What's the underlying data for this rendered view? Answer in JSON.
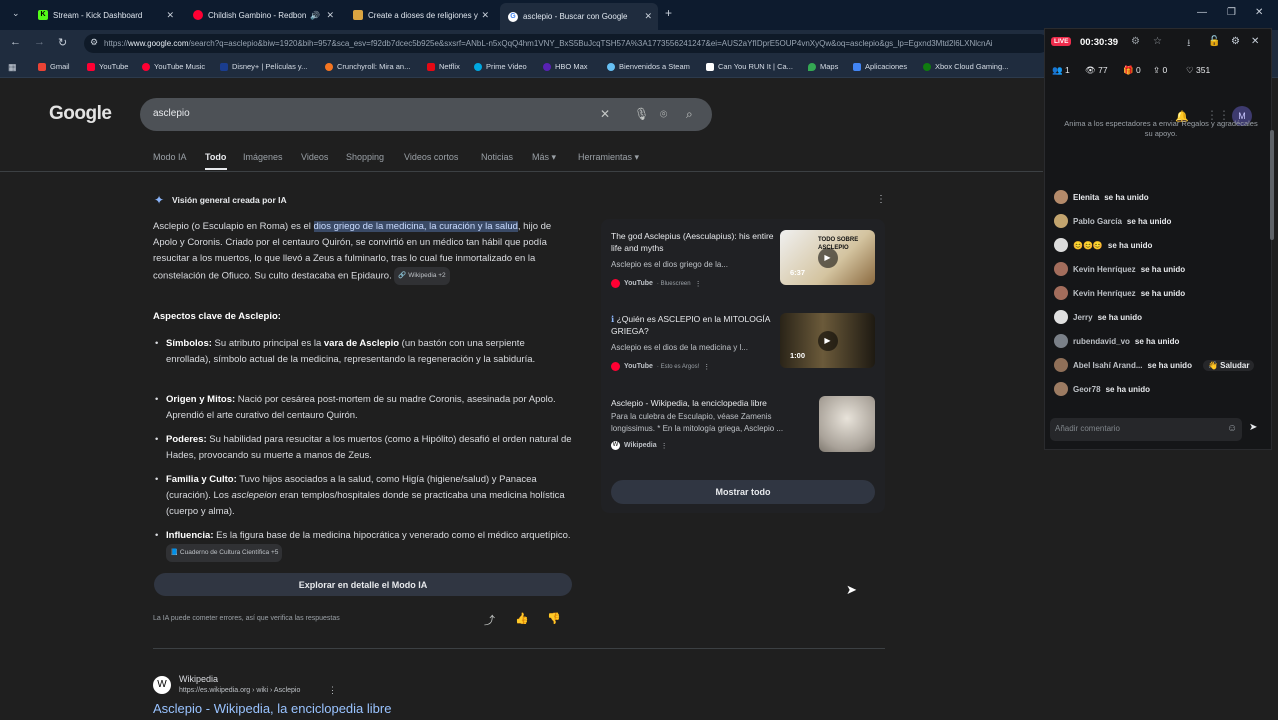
{
  "browser": {
    "tabs": [
      {
        "label": "Stream - Kick Dashboard",
        "favicon_color": "#53fc18"
      },
      {
        "label": "Childish Gambino - Redbone",
        "favicon_color": "#ff0033"
      },
      {
        "label": "Create a dioses de religiones y",
        "favicon_color": "#d9a441"
      },
      {
        "label": "asclepio - Buscar con Google",
        "favicon_color": "#4285f4"
      }
    ],
    "url_prefix": "https://",
    "url_host": "www.google.com",
    "url_rest": "/search?q=asclepio&biw=1920&bih=957&sca_esv=f92db7dcec5b925e&sxsrf=ANbL-n5xQqQ4hm1VNY_BxS5BuJcqTSH57A%3A1773556241247&ei=AUS2aYfIDprE5OUP4vnXyQw&oq=asclepio&gs_lp=Egxnd3Mtd2l6LXNlcnAi",
    "bookmarks": [
      {
        "label": "Gmail",
        "color": "#ea4335"
      },
      {
        "label": "YouTube",
        "color": "#ff0033"
      },
      {
        "label": "YouTube Music",
        "color": "#ff0033"
      },
      {
        "label": "Disney+ | Películas y...",
        "color": "#1a3d8f"
      },
      {
        "label": "Crunchyroll: Mira an...",
        "color": "#f47521"
      },
      {
        "label": "Netflix",
        "color": "#e50914"
      },
      {
        "label": "Prime Video",
        "color": "#00a8e1"
      },
      {
        "label": "HBO Max",
        "color": "#5822b4"
      },
      {
        "label": "Bienvenidos a Steam",
        "color": "#1b2838"
      },
      {
        "label": "Can You RUN It | Ca...",
        "color": "#ffffff"
      },
      {
        "label": "Maps",
        "color": "#34a853"
      },
      {
        "label": "Aplicaciones",
        "color": "#4285f4"
      },
      {
        "label": "Xbox Cloud Gaming...",
        "color": "#107c10"
      }
    ]
  },
  "google": {
    "logo": "Google",
    "query": "asclepio",
    "tabs": [
      "Modo IA",
      "Todo",
      "Imágenes",
      "Videos",
      "Shopping",
      "Videos cortos",
      "Noticias",
      "Más ▾",
      "Herramientas ▾"
    ],
    "ai_overview_title": "Visión general creada por IA",
    "intro_before": "Asclepio (o Esculapio en Roma) es el ",
    "intro_highlight": "dios griego de la medicina, la curación y la salud",
    "intro_after": ", hijo de Apolo y Coronis. Criado por el centauro Quirón, se convirtió en un médico tan hábil que podía resucitar a los muertos, lo que llevó a Zeus a fulminarlo, tras lo cual fue inmortalizado en la constelación de Ofiuco. Su culto destacaba en Epidauro.",
    "intro_chip": "Wikipedia +2",
    "key_aspects_title": "Aspectos clave de Asclepio:",
    "bullets": [
      {
        "term": "Símbolos:",
        "text_before": " Su atributo principal es la ",
        "bold2": "vara de Asclepio",
        "text_after": " (un bastón con una serpiente enrollada), símbolo actual de la medicina, representando la regeneración y la sabiduría."
      },
      {
        "term": "Origen y Mitos:",
        "text": " Nació por cesárea post-mortem de su madre Coronis, asesinada por Apolo. Aprendió el arte curativo del centauro Quirón."
      },
      {
        "term": "Poderes:",
        "text": " Su habilidad para resucitar a los muertos (como a Hipólito) desafió el orden natural de Hades, provocando su muerte a manos de Zeus."
      },
      {
        "term": "Familia y Culto:",
        "text_before": " Tuvo hijos asociados a la salud, como Higía (higiene/salud) y Panacea (curación). Los ",
        "italic": "asclepeion",
        "text_after": " eran templos/hospitales donde se practicaba una medicina holística (cuerpo y alma)."
      },
      {
        "term": "Influencia:",
        "text": " Es la figura base de la medicina hipocrática y venerado como el médico arquetípico.",
        "chip": "Cuaderno de Cultura Científica +5"
      }
    ],
    "explore_button": "Explorar en detalle el Modo IA",
    "disclaimer": "La IA puede cometer errores, así que verifica las respuestas",
    "sources": [
      {
        "title": "The god Asclepius (Aesculapius): his entire life and myths",
        "snippet": "Asclepio es el dios griego de la...",
        "site": "YouTube",
        "extra": "· Bluescreen",
        "duration": "6:37",
        "thumb_text": "TODO SOBRE ASCLEPIO"
      },
      {
        "title": "¿Quién es ASCLEPIO en la MITOLOGÍA GRIEGA?",
        "snippet": "Asclepio es el dios de la medicina y l...",
        "site": "YouTube",
        "extra": "· Esto es Argos!",
        "duration": "1:00"
      },
      {
        "title": "Asclepio - Wikipedia, la enciclopedia libre",
        "snippet": "Para la culebra de Esculapio, véase Zamenis longissimus. * En la mitología griega, Asclepio ...",
        "site": "Wikipedia"
      }
    ],
    "show_all": "Mostrar todo",
    "result": {
      "site": "Wikipedia",
      "url": "https://es.wikipedia.org › wiki › Asclepio",
      "title": "Asclepio - Wikipedia, la enciclopedia libre"
    }
  },
  "stream": {
    "live_badge": "LIVE",
    "timer": "00:30:39",
    "stats": [
      "1",
      "77",
      "0",
      "0",
      "351"
    ],
    "hint": "Anima a los espectadores a enviar Regalos y agradécales su apoyo.",
    "joined": "se ha unido",
    "chat": [
      {
        "user": "Elenita"
      },
      {
        "user": "Pablo García"
      },
      {
        "user": "😊😊😊"
      },
      {
        "user": "Kevin Henríquez"
      },
      {
        "user": "Kevin Henríquez"
      },
      {
        "user": "Jerry"
      },
      {
        "user": "rubendavid_vo"
      },
      {
        "user": "Abel Isahí Arand...",
        "greet": "👋 Saludar"
      },
      {
        "user": "Geor78"
      }
    ],
    "input_placeholder": "Añadir comentario"
  }
}
